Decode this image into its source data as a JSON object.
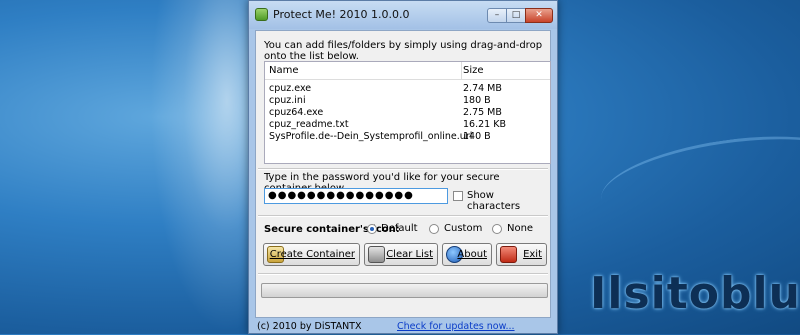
{
  "window": {
    "title": "Protect Me! 2010 1.0.0.0",
    "controls": {
      "minimize": "–",
      "maximize": "□",
      "close": "✕"
    }
  },
  "intro": "You can add files/folders by simply using drag-and-drop onto the list below.",
  "file_list": {
    "columns": [
      "Name",
      "Size"
    ],
    "rows": [
      {
        "name": "cpuz.exe",
        "size": "2.74 MB"
      },
      {
        "name": "cpuz.ini",
        "size": "180 B"
      },
      {
        "name": "cpuz64.exe",
        "size": "2.75 MB"
      },
      {
        "name": "cpuz_readme.txt",
        "size": "16.21 KB"
      },
      {
        "name": "SysProfile.de--Dein_Systemprofil_online.url",
        "size": "140 B"
      }
    ]
  },
  "password": {
    "label": "Type in the password you'd like for your secure container below.",
    "value": "●●●●●●●●●●●●●●●",
    "show_characters_label": "Show characters",
    "show_characters_checked": false
  },
  "icon_options": {
    "label": "Secure container's icon:",
    "options": [
      "Default",
      "Custom",
      "None"
    ],
    "selected": "Default"
  },
  "buttons": {
    "create": "Create Container",
    "clear": "Clear List",
    "about": "About",
    "exit": "Exit"
  },
  "progress_value": 0,
  "status": {
    "copyright": "(c) 2010 by DiSTANTX",
    "updates_link": "Check for updates now..."
  },
  "watermark": "Ilsitoblu",
  "icons": {
    "app": "shield-icon",
    "create": "container-icon",
    "clear": "trash-icon",
    "about": "info-icon",
    "exit": "exit-icon"
  },
  "colors": {
    "desktop": "#2f7fc4",
    "titlebar": "#a3c1e6",
    "link": "#0a3cc8",
    "close": "#c8432a"
  }
}
